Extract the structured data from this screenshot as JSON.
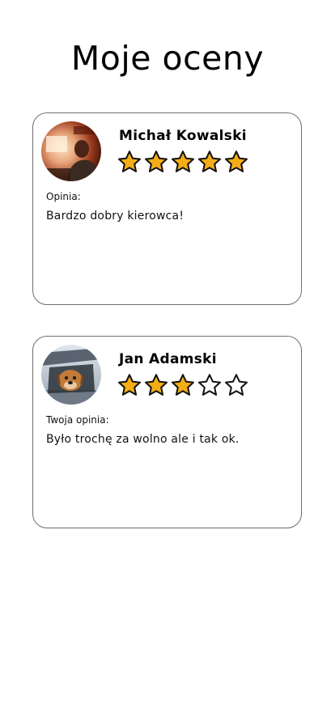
{
  "page": {
    "title": "Moje oceny"
  },
  "colors": {
    "star_filled": "#f5ad16",
    "star_empty": "#ffffff",
    "star_stroke": "#111111",
    "card_border": "#6e6e6e"
  },
  "reviews": [
    {
      "name": "Michał Kowalski",
      "rating": 5,
      "max_rating": 5,
      "opinion_label": "Opinia:",
      "opinion_text": "Bardzo dobry kierowca!"
    },
    {
      "name": "Jan Adamski",
      "rating": 3,
      "max_rating": 5,
      "opinion_label": "Twoja opinia:",
      "opinion_text": "Było trochę za wolno ale i tak ok."
    }
  ]
}
